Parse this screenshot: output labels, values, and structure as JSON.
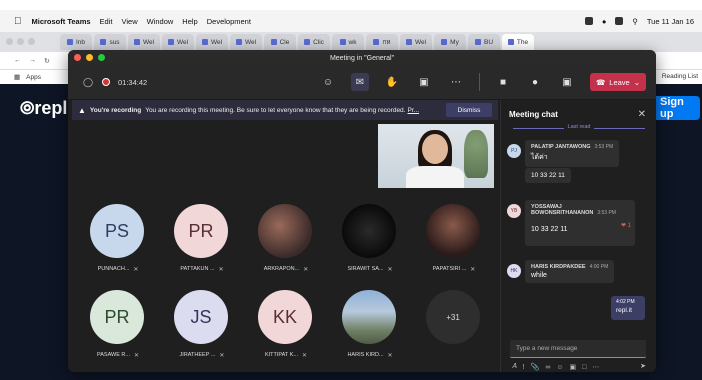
{
  "menubar": {
    "app": "Microsoft Teams",
    "items": [
      "Edit",
      "View",
      "Window",
      "Help",
      "Development"
    ],
    "clock": "Tue 11 Jan 16"
  },
  "browser": {
    "tabs": [
      "Inb",
      "sus",
      "Wel",
      "Wel",
      "Wel",
      "Wel",
      "Cle",
      "Clic",
      "wk",
      "กห",
      "Wel",
      "My",
      "BU",
      "The"
    ],
    "bookmarks": [
      "Apps"
    ],
    "reading_list": "Reading List"
  },
  "replit": {
    "logo": "repl",
    "signup": "Sign up"
  },
  "teams": {
    "title": "Meeting in \"General\"",
    "timer": "01:34:42",
    "leave_label": "Leave",
    "banner": {
      "strong": "You're recording",
      "text": "You are recording this meeting. Be sure to let everyone know that they are being recorded.",
      "link": "Pr...",
      "dismiss": "Dismiss"
    },
    "participants": [
      {
        "initials": "PS",
        "name": "PUNNACH..."
      },
      {
        "initials": "PR",
        "name": "PATTAKUN ..."
      },
      {
        "initials": "",
        "name": "ARKRAPON..."
      },
      {
        "initials": "",
        "name": "SIRAWIT SA..."
      },
      {
        "initials": "",
        "name": "PAPATSIRI ..."
      },
      {
        "initials": "PR",
        "name": "PASAWE R..."
      },
      {
        "initials": "JS",
        "name": "JIRATHEEP ..."
      },
      {
        "initials": "KK",
        "name": "KITTIPAT K..."
      },
      {
        "initials": "",
        "name": "HARIS KIRD..."
      },
      {
        "initials": "+31",
        "name": ""
      }
    ]
  },
  "chat": {
    "title": "Meeting chat",
    "last_read": "Last read",
    "messages": [
      {
        "initials": "PJ",
        "sender": "PALATIP JANTAWONG",
        "time": "3:53 PM",
        "text": "ได้ค่า",
        "reply": "10 33 22 11"
      },
      {
        "initials": "YB",
        "sender": "YOSSAWAJ BOWONSRITHANANON",
        "time": "3:53 PM",
        "text": "10 33 22 11",
        "reaction": "1"
      },
      {
        "initials": "HK",
        "sender": "HARIS KIRDPAKDEE",
        "time": "4:00 PM",
        "text": "while"
      }
    ],
    "mine": {
      "time": "4:02 PM",
      "text": "repl.it"
    },
    "compose_placeholder": "Type a new message"
  }
}
